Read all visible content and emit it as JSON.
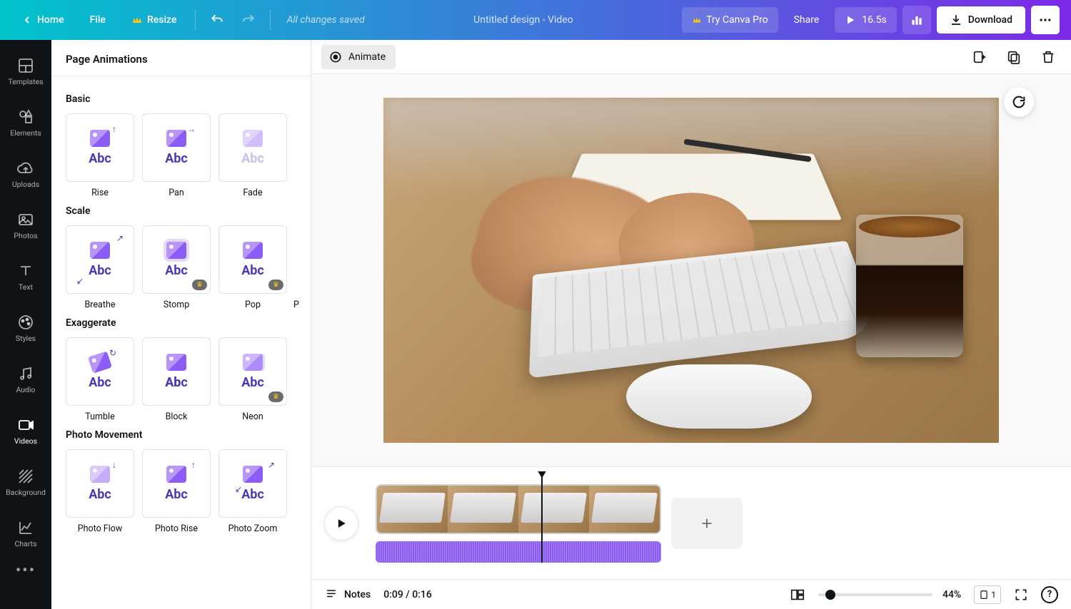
{
  "topbar": {
    "home": "Home",
    "file": "File",
    "resize": "Resize",
    "status": "All changes saved",
    "title": "Untitled design - Video",
    "tryPro": "Try Canva Pro",
    "share": "Share",
    "duration": "16.5s",
    "download": "Download"
  },
  "sidenav": {
    "items": [
      {
        "label": "Templates"
      },
      {
        "label": "Elements"
      },
      {
        "label": "Uploads"
      },
      {
        "label": "Photos"
      },
      {
        "label": "Text"
      },
      {
        "label": "Styles"
      },
      {
        "label": "Audio"
      },
      {
        "label": "Videos"
      },
      {
        "label": "Background"
      },
      {
        "label": "Charts"
      }
    ]
  },
  "panel": {
    "title": "Page Animations",
    "sections": {
      "basic": {
        "label": "Basic",
        "items": [
          "Rise",
          "Pan",
          "Fade"
        ]
      },
      "scale": {
        "label": "Scale",
        "items": [
          "Breathe",
          "Stomp",
          "Pop",
          "P"
        ]
      },
      "exaggerate": {
        "label": "Exaggerate",
        "items": [
          "Tumble",
          "Block",
          "Neon"
        ]
      },
      "photoMovement": {
        "label": "Photo Movement",
        "items": [
          "Photo Flow",
          "Photo Rise",
          "Photo Zoom"
        ]
      }
    },
    "abc": "Abc"
  },
  "canvasToolbar": {
    "animate": "Animate"
  },
  "status": {
    "notes": "Notes",
    "time": "0:09 / 0:16",
    "zoom": "44%",
    "pages": "1",
    "help": "?"
  }
}
